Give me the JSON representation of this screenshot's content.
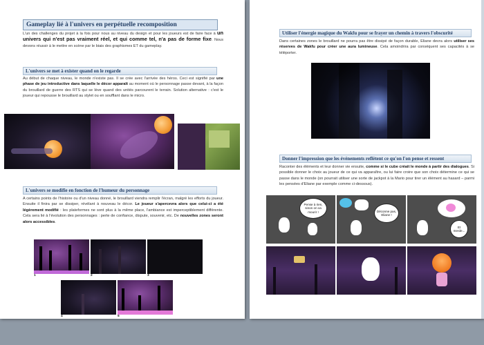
{
  "left": {
    "title": "Gameplay lié à l'univers  en perpétuelle  recomposition",
    "intro": {
      "p1": "L'un des challenges du projet à la fois pour nous au niveau du design et pour les joueurs est de faire face à",
      "p_big": "un univers qui n'est pas vraiment réel, et qui comme tel, n'a pas de forme fixe",
      "p2": ". Nous devons réussir à le mettre en scène par le biais des graphismes ET du gameplay."
    },
    "section1": {
      "heading": "L'univers se met à exister quand on le regarde",
      "text_a": "Au début de chaque niveau, le monde n'existe pas. Il se crée avec l'arrivée des héros. Ceci est signifié par",
      "text_b": "une phase de jeu introductive dans laquelle le décor apparaît",
      "text_c": "au moment où le personnage passe devant, à la façon du brouillard de guerre des RTS qui se lève quand des unités parcourent le terrain. Solution alternative : c'est le joueur qui repousse le brouillard au stylet ou en soufflant dans le micro."
    },
    "section2": {
      "heading": "L'univers se modifie en fonction de l'humeur du personnage",
      "text_a": "A certains points de l'histoire ou d'un niveau donné, le brouillard viendra remplir l'écran, malgré les efforts du joueur. Ensuite il finira par se dissiper, révélant à nouveau le décor.",
      "text_b": "Le joueur s'apercevra alors que celui-ci a été légèrement modifié",
      "text_c": ": les plateformes ne sont plus à la même place, l'ambiance est imperceptiblement différente. Cela sera lié à l'évolution des personnages : perte de confiance, dispute, souvenir, etc. De",
      "text_d": "nouvelles zones seront alors accessibles",
      "text_e": "."
    },
    "figure_numbers": [
      "1",
      "2",
      "3",
      "4",
      "5"
    ]
  },
  "right": {
    "section1": {
      "heading": "Utiliser l'énergie magique du Wakfu pour se frayer un chemin à travers l'obscurité",
      "text_a": "Dans certaines zones le brouillard ne pourra pas être dissipé de façon durable, Eliane devra alors",
      "text_b": "utiliser ses réserves de Wakfu pour créer une aura lumineuse",
      "text_c": ". Cela amoindrira par conséquent ses capacités à se téléporter."
    },
    "section2": {
      "heading": "Donner l'impression que les événements reflètent ce qu'on l'on pense et ressent",
      "text_a": "Raconter des éléments et leur donner vie ensuite,",
      "text_b": "comme si le cube créait le monde à partir des dialogues",
      "text_c": ". Si possible donner le choix au joueur de ce qui va apparaître, ou lui faire croire que son choix détermine ce qui se passe dans le monde (on pourrait utiliser une sorte de jackpot à la Mario pour tirer un élément au hasard – parmi les pensées d'Eliane par exemple comme ci-dessous)."
    },
    "comic": {
      "bubble1": "Pense à rien, sinon on va mourir !",
      "bubble2": "Déconne pas, Eliane !",
      "bubble3": "Et merde..."
    }
  },
  "colors": {
    "heading_text": "#233f66",
    "heading_border": "#7f9ab6",
    "background": "#8f9aa6"
  }
}
